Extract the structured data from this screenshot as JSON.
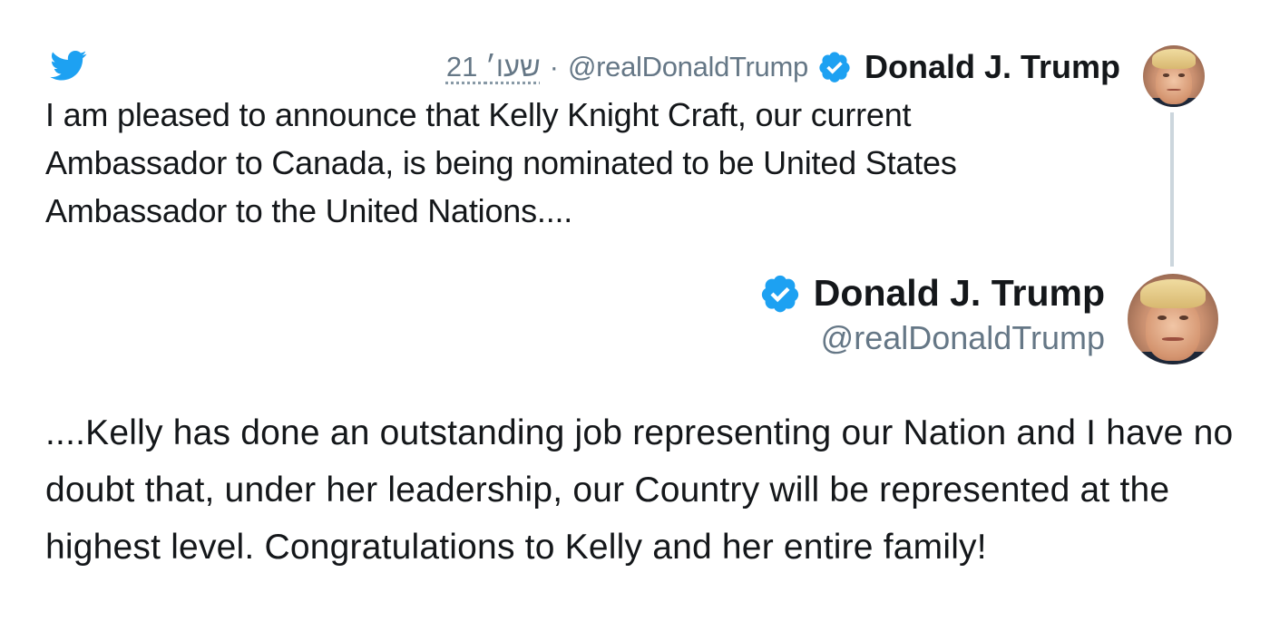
{
  "colors": {
    "twitter_blue": "#1da1f2",
    "text": "#14171a",
    "muted": "#657786",
    "thread_line": "#ccd6dd"
  },
  "icons": {
    "brand": "twitter-bird-icon",
    "verified": "verified-badge-icon"
  },
  "tweet1": {
    "date": "21 שעו׳",
    "separator": "·",
    "handle": "@realDonaldTrump",
    "name": "Donald J. Trump",
    "text": "I am pleased to announce that Kelly Knight Craft, our current Ambassador to Canada, is being nominated to be United States Ambassador to the United Nations...."
  },
  "tweet2": {
    "name": "Donald J. Trump",
    "handle": "@realDonaldTrump",
    "text": "....Kelly has done an outstanding job representing our Nation and I have no doubt that, under her leadership, our Country will be represented at the highest level. Congratulations to Kelly and her entire family!"
  }
}
